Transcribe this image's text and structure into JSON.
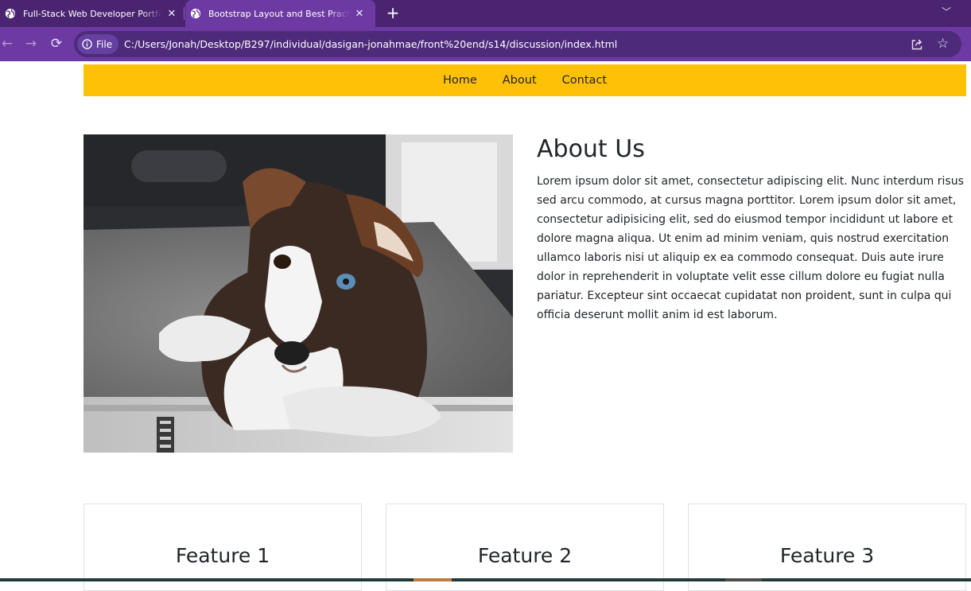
{
  "browser": {
    "tabs": [
      {
        "title": "Full-Stack Web Developer Portfolio",
        "active": false
      },
      {
        "title": "Bootstrap Layout and Best Practices",
        "active": true
      }
    ],
    "address_chip": "File",
    "url": "C:/Users/Jonah/Desktop/B297/individual/dasigan-jonahmae/front%20end/s14/discussion/index.html",
    "colors": {
      "frame": "#4a2470",
      "toolbar": "#6d3aa3",
      "omnibox": "#4d2a7a"
    }
  },
  "navbar": {
    "color": "#ffc107",
    "links": [
      "Home",
      "About",
      "Contact"
    ]
  },
  "about": {
    "image_subject": "husky puppy lying on a rug",
    "title": "About Us",
    "text": "Lorem ipsum dolor sit amet, consectetur adipiscing elit. Nunc interdum risus sed arcu commodo, at cursus magna porttitor. Lorem ipsum dolor sit amet, consectetur adipisicing elit, sed do eiusmod tempor incididunt ut labore et dolore magna aliqua. Ut enim ad minim veniam, quis nostrud exercitation ullamco laboris nisi ut aliquip ex ea commodo consequat. Duis aute irure dolor in reprehenderit in voluptate velit esse cillum dolore eu fugiat nulla pariatur. Excepteur sint occaecat cupidatat non proident, sunt in culpa qui officia deserunt mollit anim id est laborum."
  },
  "features": [
    {
      "title": "Feature 1"
    },
    {
      "title": "Feature 2"
    },
    {
      "title": "Feature 3"
    }
  ]
}
